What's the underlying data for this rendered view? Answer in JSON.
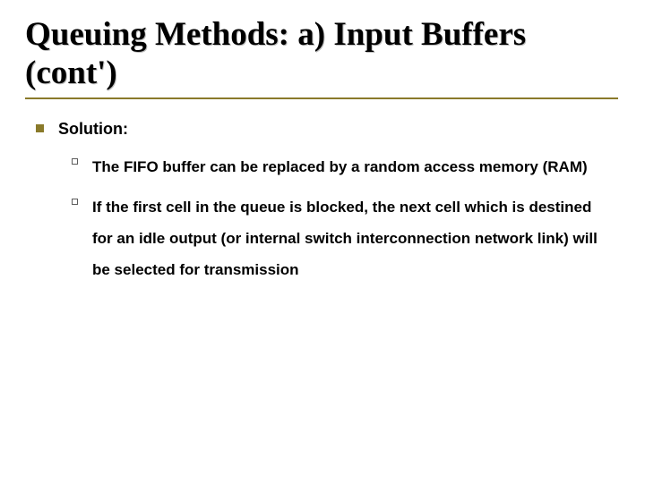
{
  "title": "Queuing Methods: a) Input Buffers (cont')",
  "solution_label": "Solution:",
  "points": [
    "The FIFO buffer can be replaced by a random access memory (RAM)",
    "If the first cell in the queue is blocked, the next cell which is destined for an idle output (or internal switch interconnection network link) will be selected for transmission"
  ]
}
